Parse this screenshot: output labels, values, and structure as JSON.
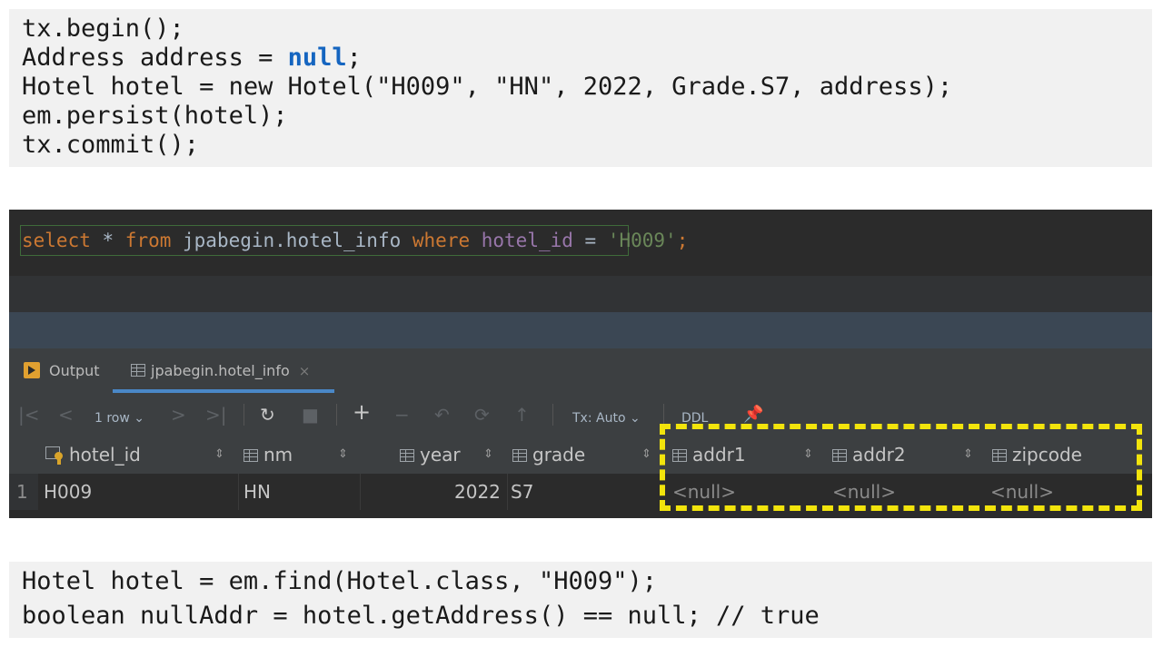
{
  "code_top": {
    "lines": [
      "tx.begin();",
      "Address address = ",
      "Hotel hotel = new Hotel(\"H009\", \"HN\", 2022, Grade.S7, address);",
      "em.persist(hotel);",
      "tx.commit();"
    ],
    "null_keyword": "null",
    "semicolon": ";"
  },
  "query": {
    "select": "select",
    "star": " * ",
    "from": "from",
    "table": " jpabegin.hotel_info ",
    "where": "where",
    "column": " hotel_id",
    "eq": " = ",
    "value": "'H009'",
    "end": ";"
  },
  "tabs": [
    {
      "label": "Output"
    },
    {
      "label": "jpabegin.hotel_info",
      "close": "×"
    }
  ],
  "toolbar": {
    "first": "|<",
    "prev": "<",
    "rows": "1 row",
    "rows_arrow": "⌄",
    "next": ">",
    "last": ">|",
    "refresh": "↻",
    "stop": "■",
    "add": "+",
    "remove": "−",
    "revert": "↶",
    "submit": "⟳",
    "up": "↑",
    "tx": "Tx: Auto",
    "tx_arrow": "⌄",
    "ddl": "DDL",
    "pin": "📌"
  },
  "columns": [
    {
      "name": "hotel_id",
      "sort": "⇕"
    },
    {
      "name": "nm",
      "sort": "⇕"
    },
    {
      "name": "year",
      "sort": "⇕"
    },
    {
      "name": "grade",
      "sort": "⇕"
    },
    {
      "name": "addr1",
      "sort": "⇕"
    },
    {
      "name": "addr2",
      "sort": "⇕"
    },
    {
      "name": "zipcode",
      "sort": ""
    }
  ],
  "rows": [
    {
      "num": "1",
      "cells": [
        "H009",
        "HN",
        "2022",
        "S7",
        "<null>",
        "<null>",
        "<null>"
      ]
    }
  ],
  "code_bottom": {
    "lines": [
      "Hotel hotel = em.find(Hotel.class, \"H009\");",
      "boolean nullAddr = hotel.getAddress() == null; // true"
    ]
  },
  "colors": {
    "highlight": "#f2e40c",
    "keyword": "#cc7832",
    "string": "#6a8759",
    "null_keyword": "#1565c0"
  }
}
